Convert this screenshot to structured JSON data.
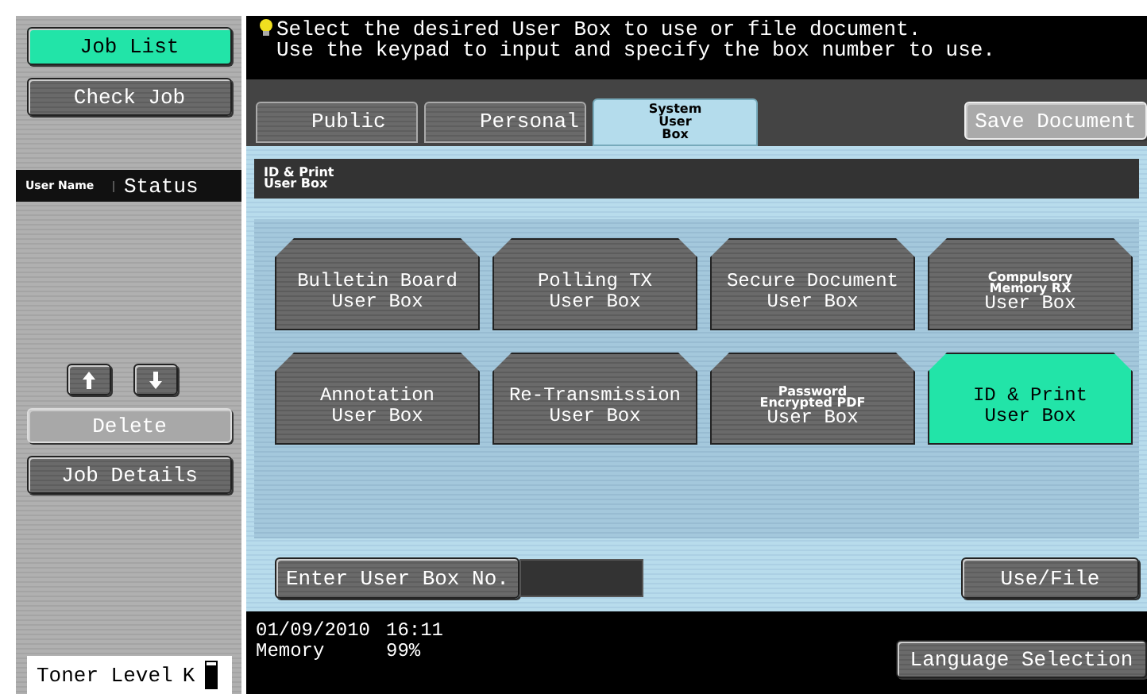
{
  "sidebar": {
    "buttons": [
      {
        "label": "Job List",
        "selected": true
      },
      {
        "label": "Check Job",
        "selected": false
      }
    ],
    "columns": [
      {
        "label": "User Name",
        "small": true
      },
      {
        "label": "Status",
        "small": false
      }
    ],
    "delete": {
      "label": "Delete",
      "disabled": true
    },
    "job_details": {
      "label": "Job Details"
    },
    "toner": {
      "label": "Toner Level",
      "color_label": "K",
      "level": 0.9
    }
  },
  "message": [
    "Select the desired User Box to use or file document.",
    "Use the keypad to input and specify the box number to use."
  ],
  "tabs": [
    {
      "label": "Public",
      "selected": false
    },
    {
      "label": "Personal",
      "selected": false
    },
    {
      "label": "System User Box",
      "selected": true
    }
  ],
  "save_document": {
    "label": "Save Document"
  },
  "breadcrumb": "ID & Print User Box",
  "boxes": [
    {
      "top": [
        "Bulletin Board"
      ],
      "small": false,
      "bottom": "User Box",
      "selected": false
    },
    {
      "top": [
        "Polling TX"
      ],
      "small": false,
      "bottom": "User Box",
      "selected": false
    },
    {
      "top": [
        "Secure Document"
      ],
      "small": false,
      "bottom": "User Box",
      "selected": false
    },
    {
      "top": [
        "Compulsory",
        "Memory RX"
      ],
      "small": true,
      "bottom": "User Box",
      "selected": false
    },
    {
      "top": [
        "Annotation"
      ],
      "small": false,
      "bottom": "User Box",
      "selected": false
    },
    {
      "top": [
        "Re-Transmission"
      ],
      "small": false,
      "bottom": "User Box",
      "selected": false
    },
    {
      "top": [
        "Password",
        "Encrypted PDF"
      ],
      "small": true,
      "bottom": "User Box",
      "selected": false
    },
    {
      "top": [
        "ID & Print"
      ],
      "small": false,
      "bottom": "User Box",
      "selected": true
    }
  ],
  "enter_box": {
    "label": "Enter User Box No."
  },
  "use_file": {
    "label": "Use/File"
  },
  "footer": {
    "date": "01/09/2010",
    "time": "16:11",
    "memory_label": "Memory",
    "memory_value": "99%",
    "language": "Language Selection"
  }
}
